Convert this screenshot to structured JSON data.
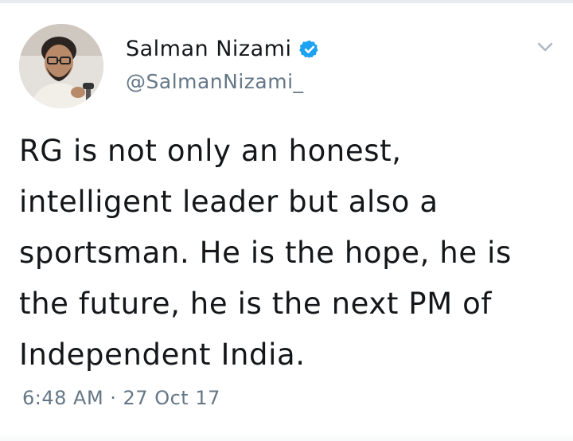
{
  "tweet": {
    "author": {
      "display_name": "Salman Nizami",
      "handle": "@SalmanNizami_",
      "verified": true,
      "avatar_icon": "profile-photo"
    },
    "text_lines": [
      "RG is not only an honest,",
      "intelligent leader but also a",
      "sportsman. He is the hope, he is",
      "the future, he is the next PM of",
      "Independent India."
    ],
    "timestamp": "6:48 AM · 27 Oct 17",
    "menu_icon": "chevron-down-icon"
  },
  "colors": {
    "text_primary": "#14171a",
    "text_secondary": "#657786",
    "verified_blue": "#1da1f2",
    "chevron": "#aab8c2"
  }
}
